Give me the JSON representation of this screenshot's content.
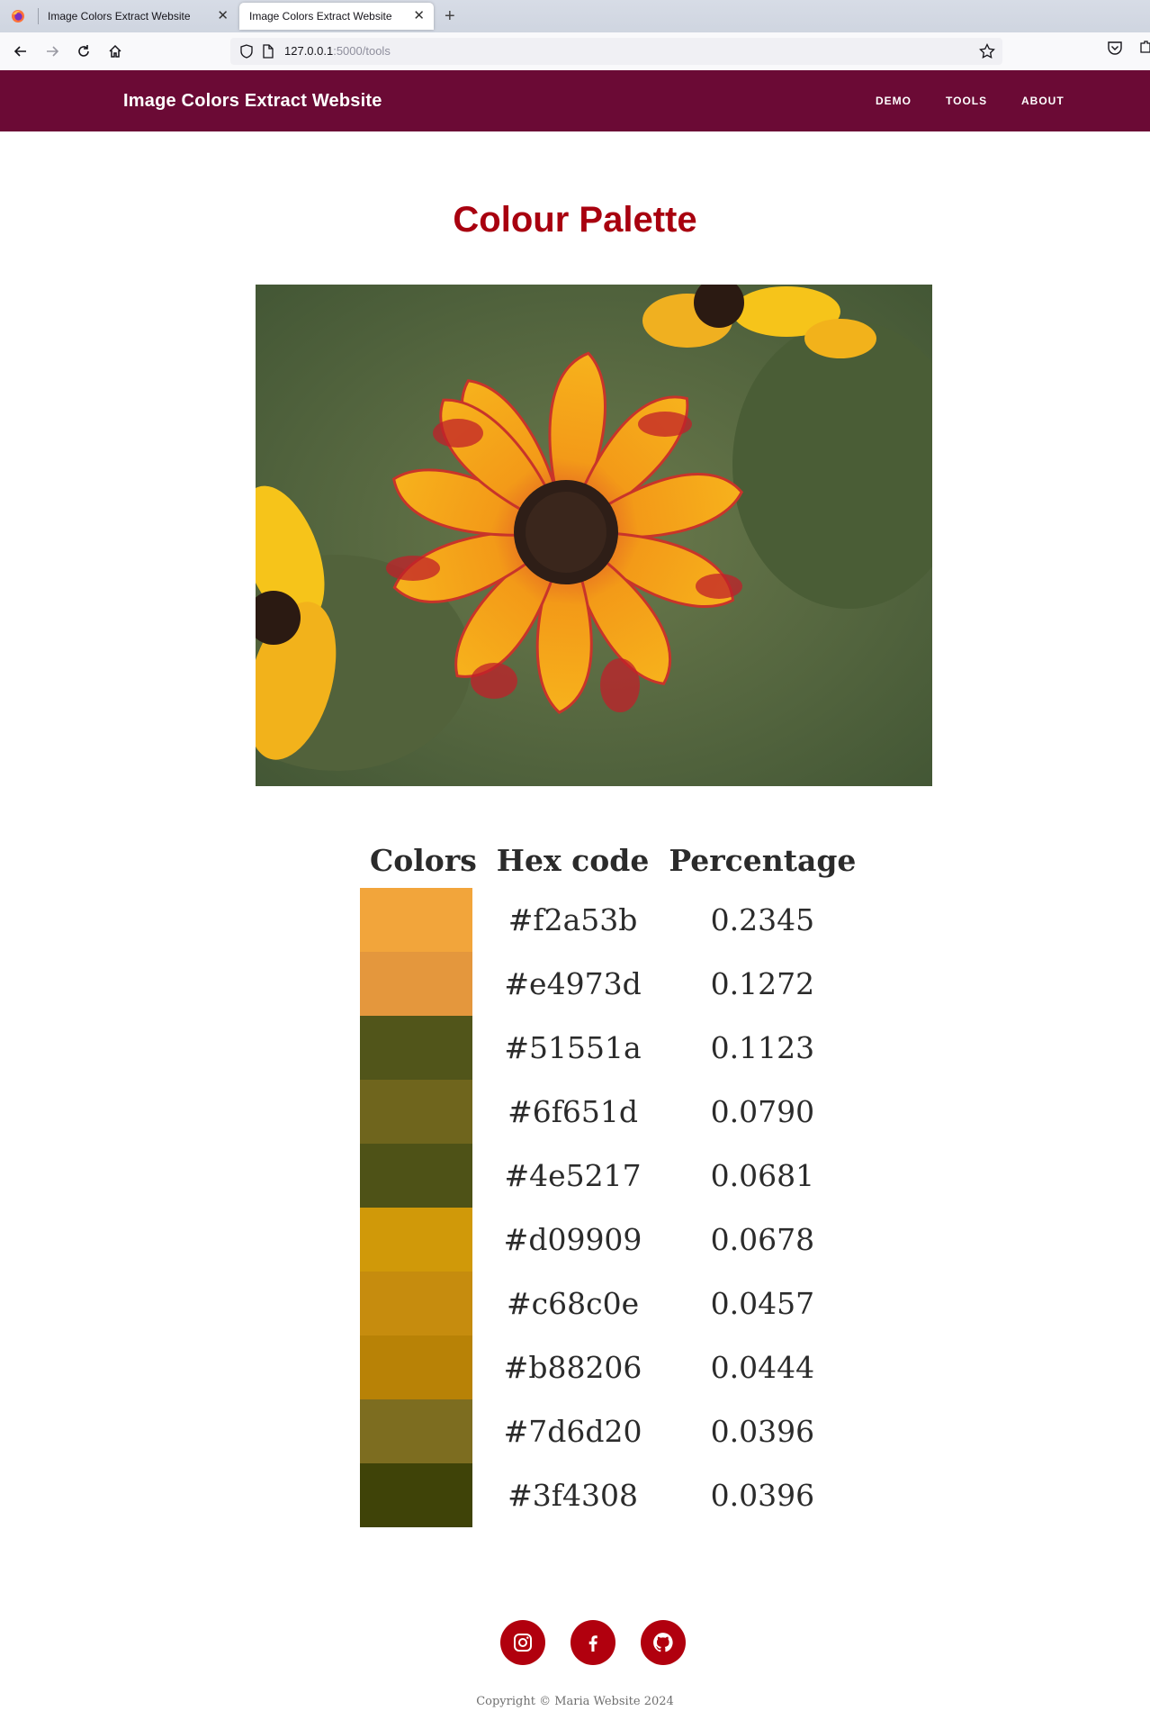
{
  "browser": {
    "tabs": [
      {
        "title": "Image Colors Extract Website",
        "active": false
      },
      {
        "title": "Image Colors Extract Website",
        "active": true
      }
    ],
    "url_host": "127.0.0.1",
    "url_rest": ":5000/tools"
  },
  "site": {
    "brand": "Image Colors Extract Website",
    "nav": [
      "DEMO",
      "TOOLS",
      "ABOUT"
    ],
    "accent_color": "#6b0a35",
    "title_color": "#a8000f"
  },
  "main": {
    "title": "Colour Palette",
    "table": {
      "headers": [
        "Colors",
        "Hex code",
        "Percentage"
      ],
      "rows": [
        {
          "hex": "#f2a53b",
          "percentage": "0.2345"
        },
        {
          "hex": "#e4973d",
          "percentage": "0.1272"
        },
        {
          "hex": "#51551a",
          "percentage": "0.1123"
        },
        {
          "hex": "#6f651d",
          "percentage": "0.0790"
        },
        {
          "hex": "#4e5217",
          "percentage": "0.0681"
        },
        {
          "hex": "#d09909",
          "percentage": "0.0678"
        },
        {
          "hex": "#c68c0e",
          "percentage": "0.0457"
        },
        {
          "hex": "#b88206",
          "percentage": "0.0444"
        },
        {
          "hex": "#7d6d20",
          "percentage": "0.0396"
        },
        {
          "hex": "#3f4308",
          "percentage": "0.0396"
        }
      ]
    }
  },
  "footer": {
    "social": [
      "instagram-icon",
      "facebook-icon",
      "github-icon"
    ],
    "copyright": "Copyright © Maria Website 2024"
  }
}
